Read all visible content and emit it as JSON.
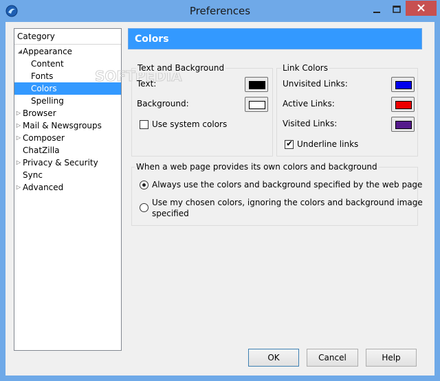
{
  "window": {
    "title": "Preferences",
    "close_label": "✕",
    "minimize_label": "—",
    "maximize_label": "▢"
  },
  "sidebar": {
    "header": "Category",
    "items": [
      {
        "label": "Appearance",
        "twisty": "◢"
      },
      {
        "label": "Content"
      },
      {
        "label": "Fonts"
      },
      {
        "label": "Colors"
      },
      {
        "label": "Spelling"
      },
      {
        "label": "Browser",
        "twisty": "▷"
      },
      {
        "label": "Mail & Newsgroups",
        "twisty": "▷"
      },
      {
        "label": "Composer",
        "twisty": "▷"
      },
      {
        "label": "ChatZilla"
      },
      {
        "label": "Privacy & Security",
        "twisty": "▷"
      },
      {
        "label": "Sync"
      },
      {
        "label": "Advanced",
        "twisty": "▷"
      }
    ],
    "selected": "Colors"
  },
  "main": {
    "heading": "Colors",
    "text_bg": {
      "title": "Text and Background",
      "text_label": "Text:",
      "text_color": "#000000",
      "background_label": "Background:",
      "background_color": "#ffffff",
      "use_system_label": "Use system colors",
      "use_system_checked": false
    },
    "link_colors": {
      "title": "Link Colors",
      "unvisited_label": "Unvisited Links:",
      "unvisited_color": "#0000ee",
      "active_label": "Active Links:",
      "active_color": "#ee0000",
      "visited_label": "Visited Links:",
      "visited_color": "#551a8b",
      "underline_label": "Underline links",
      "underline_checked": true
    },
    "page_colors": {
      "title": "When a web page provides its own colors and background",
      "option_always": "Always use the colors and background specified by the web page",
      "option_mine_line1": "Use my chosen colors, ignoring the colors and background image",
      "option_mine_line2": "specified",
      "selected": "always"
    }
  },
  "buttons": {
    "ok": "OK",
    "cancel": "Cancel",
    "help": "Help"
  },
  "colors": {
    "titlebar": "#6fa9e8",
    "selection": "#3399ff",
    "close": "#c75050"
  },
  "watermark": "SOFTPEDIA"
}
